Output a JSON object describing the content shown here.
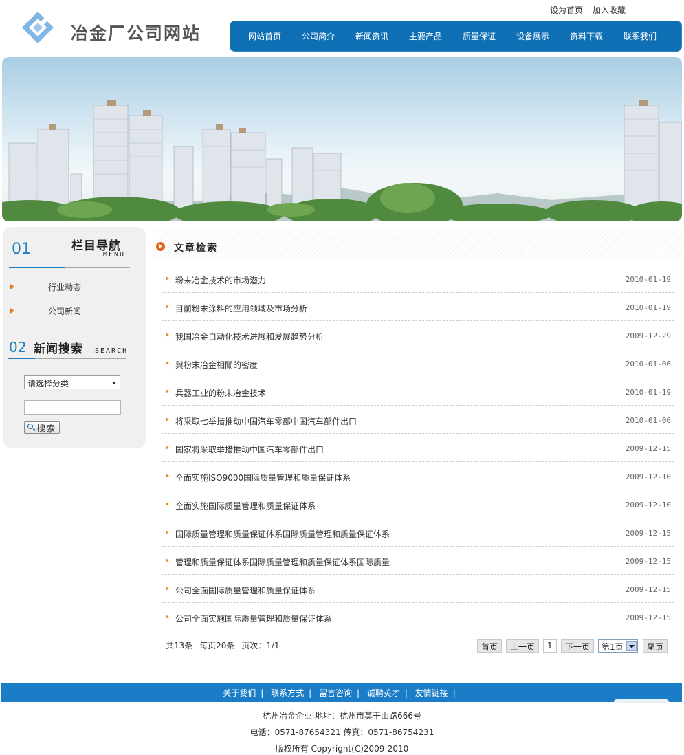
{
  "header": {
    "site_title": "冶金厂公司网站",
    "top_links": [
      "设为首页",
      "加入收藏"
    ],
    "nav": [
      "网站首页",
      "公司简介",
      "新闻资讯",
      "主要产品",
      "质量保证",
      "设备展示",
      "资料下载",
      "联系我们"
    ]
  },
  "sidebar": {
    "menu_section": {
      "num": "01",
      "title": "栏目导航",
      "en": "MENU"
    },
    "menu_items": [
      "行业动态",
      "公司新闻"
    ],
    "search_section": {
      "num": "02",
      "title": "新闻搜索",
      "en": "SEARCH"
    },
    "category_select": "请选择分类",
    "search_button": "搜索"
  },
  "main": {
    "title": "文章检索",
    "articles": [
      {
        "title": "粉末冶金技术的市场潜力",
        "date": "2010-01-19"
      },
      {
        "title": "目前粉末涂料的应用领域及市场分析",
        "date": "2010-01-19"
      },
      {
        "title": "我国冶金自动化技术进展和发展趋势分析",
        "date": "2009-12-29"
      },
      {
        "title": "與粉末冶金相關的密度",
        "date": "2010-01-06"
      },
      {
        "title": "兵器工业的粉末冶金技术",
        "date": "2010-01-19"
      },
      {
        "title": "将采取七举措推动中国汽车零部中国汽车部件出口",
        "date": "2010-01-06"
      },
      {
        "title": "国家将采取举措推动中国汽车零部件出口",
        "date": "2009-12-15"
      },
      {
        "title": "全面实施ISO9000国际质量管理和质量保证体系",
        "date": "2009-12-10"
      },
      {
        "title": "全面实施国际质量管理和质量保证体系",
        "date": "2009-12-10"
      },
      {
        "title": "国际质量管理和质量保证体系国际质量管理和质量保证体系",
        "date": "2009-12-15"
      },
      {
        "title": "管理和质量保证体系国际质量管理和质量保证体系国际质量",
        "date": "2009-12-15"
      },
      {
        "title": "公司全面国际质量管理和质量保证体系",
        "date": "2009-12-15"
      },
      {
        "title": "公司全面实施国际质量管理和质量保证体系",
        "date": "2009-12-15"
      }
    ],
    "pager": {
      "total": "共13条",
      "per_page": "每页20条",
      "page_info": "页次：1/1",
      "first": "首页",
      "prev": "上一页",
      "current": "1",
      "next": "下一页",
      "select": "第1页",
      "last": "尾页"
    }
  },
  "footer": {
    "links": [
      "关于我们",
      "联系方式",
      "留言咨询",
      "诚聘英才",
      "友情链接"
    ],
    "line1": "杭州冶金企业 地址：杭州市莫干山路666号",
    "line2": "电话：0571-87654321 传真：0571-86754231",
    "line3": "版权所有 Copyright(C)2009-2010"
  },
  "colors": {
    "nav_blue": "#0e6fb5",
    "footer_blue": "#1b7dc7",
    "accent_orange": "#e8641e"
  }
}
